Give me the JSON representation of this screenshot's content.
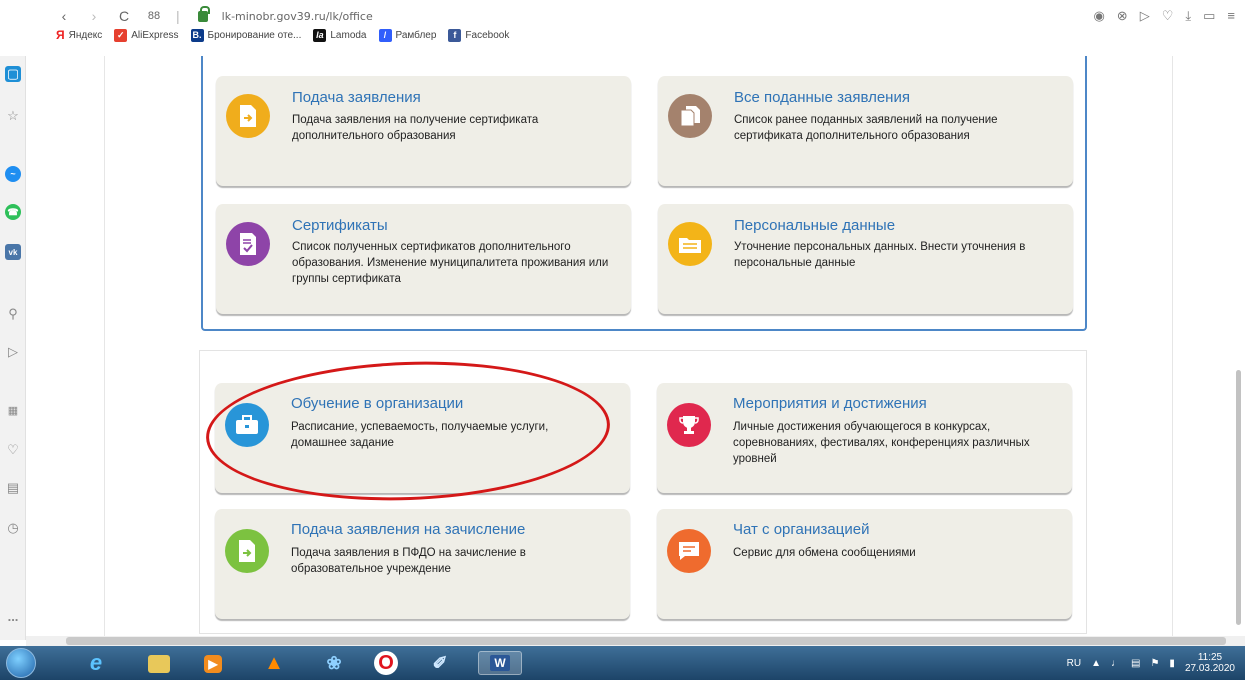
{
  "browser": {
    "url": "lk-minobr.gov39.ru/lk/office",
    "bookmarks": [
      "Яндекс",
      "AliExpress",
      "Бронирование оте...",
      "Lamoda",
      "Рамблер",
      "Facebook"
    ],
    "bookmark_icon_labels": [
      "Я",
      "",
      "B.",
      "la",
      "/",
      "f"
    ],
    "nav_grid_label": "88",
    "sidebar_more": "..."
  },
  "cards": [
    {
      "title": "Подача заявления",
      "desc": "Подача заявления на получение сертификата дополнительного образования",
      "icon": "document-arrow-icon",
      "color": "#f0ad1c"
    },
    {
      "title": "Все поданные заявления",
      "desc": "Список ранее поданных заявлений на получение сертификата дополнительного образования",
      "icon": "documents-icon",
      "color": "#a4826d"
    },
    {
      "title": "Сертификаты",
      "desc": "Список полученных сертификатов дополнительного образования. Изменение муниципалитета проживания или группы сертификата",
      "icon": "certificate-icon",
      "color": "#8e44a8"
    },
    {
      "title": "Персональные данные",
      "desc": "Уточнение персональных данных. Внести уточнения в персональные данные",
      "icon": "folder-icon",
      "color": "#f3b418"
    },
    {
      "title": "Обучение в организации",
      "desc": "Расписание, успеваемость, получаемые услуги, домашнее задание",
      "icon": "briefcase-icon",
      "color": "#2895d8"
    },
    {
      "title": "Мероприятия и достижения",
      "desc": "Личные достижения обучающегося в конкурсах, соревнованиях, фестивалях, конференциях различных уровней",
      "icon": "trophy-icon",
      "color": "#e0284e"
    },
    {
      "title": "Подача заявления на зачисление",
      "desc": "Подача заявления в ПФДО на зачисление в образовательное учреждение",
      "icon": "document-enroll-icon",
      "color": "#7cc240"
    },
    {
      "title": "Чат с организацией",
      "desc": "Сервис для обмена сообщениями",
      "icon": "chat-icon",
      "color": "#ef6b2e"
    }
  ],
  "taskbar": {
    "lang": "RU",
    "time": "11:25",
    "date": "27.03.2020",
    "app_label_word": "W"
  }
}
